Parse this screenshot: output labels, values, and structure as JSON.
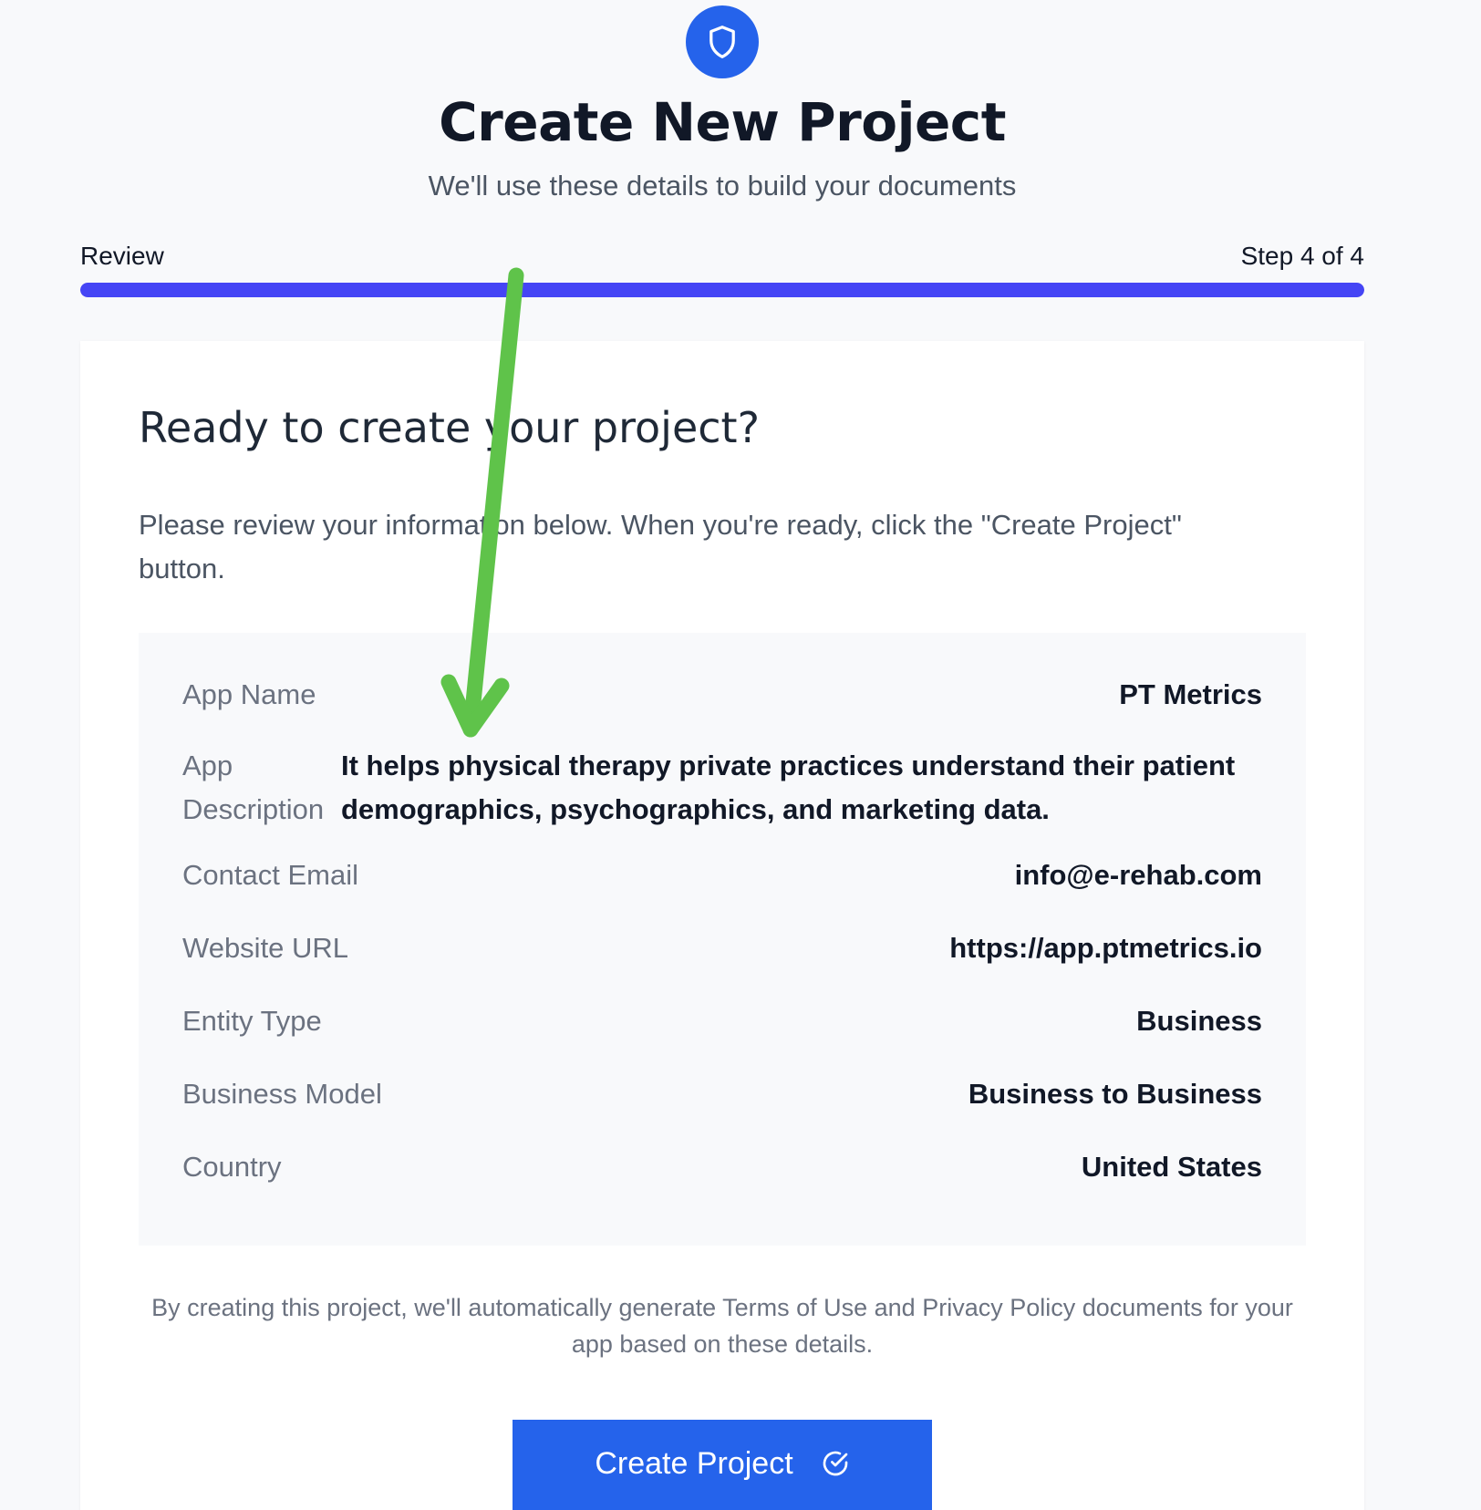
{
  "header": {
    "logo_icon": "shield-icon",
    "title": "Create New Project",
    "subtitle": "We'll use these details to build your documents"
  },
  "progress": {
    "step_label": "Review",
    "step_count": "Step 4 of 4",
    "fraction": 1.0,
    "fill_color": "#4545f5"
  },
  "card": {
    "heading": "Ready to create your project?",
    "intro": "Please review your information below. When you're ready, click the \"Create Project\" button.",
    "rows": [
      {
        "label": "App Name",
        "value": "PT Metrics"
      },
      {
        "label": "App Description",
        "value": "It helps physical therapy private practices understand their patient demographics, psychographics, and marketing data."
      },
      {
        "label": "Contact Email",
        "value": "info@e-rehab.com"
      },
      {
        "label": "Website URL",
        "value": "https://app.ptmetrics.io"
      },
      {
        "label": "Entity Type",
        "value": "Business"
      },
      {
        "label": "Business Model",
        "value": "Business to Business"
      },
      {
        "label": "Country",
        "value": "United States"
      }
    ],
    "footnote": "By creating this project, we'll automatically generate Terms of Use and Privacy Policy documents for your app based on these details.",
    "create_button_label": "Create Project",
    "create_button_icon": "check-circle-icon"
  },
  "annotation": {
    "arrow_icon": "green-arrow-icon",
    "color": "#5fc34a"
  },
  "colors": {
    "accent": "#2563eb",
    "background": "#f8f9fb"
  }
}
